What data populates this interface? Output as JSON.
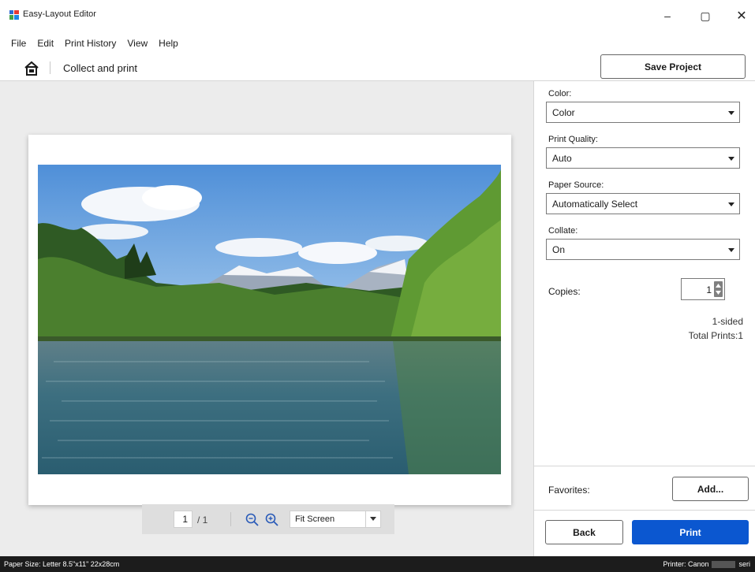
{
  "window": {
    "title": "Easy-Layout Editor",
    "minimize_glyph": "–",
    "maximize_glyph": "▢",
    "close_glyph": "✕"
  },
  "menu": {
    "items": [
      {
        "label": "File"
      },
      {
        "label": "Edit"
      },
      {
        "label": "Print History"
      },
      {
        "label": "View"
      },
      {
        "label": "Help"
      }
    ]
  },
  "breadcrumb": {
    "home_icon": "home-icon",
    "title": "Collect and print"
  },
  "toolbar": {
    "save_label": "Save Project"
  },
  "preview": {
    "photo_subject": "lake-landscape-photo",
    "page_current": "1",
    "page_total": "/ 1",
    "zoom_out_icon": "zoom-out-icon",
    "zoom_in_icon": "zoom-in-icon",
    "zoom_value": "Fit Screen"
  },
  "settings": {
    "color": {
      "label": "Color:",
      "value": "Color"
    },
    "print_quality": {
      "label": "Print Quality:",
      "value": "Auto"
    },
    "paper_source": {
      "label": "Paper Source:",
      "value": "Automatically Select"
    },
    "collate": {
      "label": "Collate:",
      "value": "On"
    },
    "copies": {
      "label": "Copies:",
      "value": "1"
    },
    "sided": "1-sided",
    "total_prints": "Total Prints:1"
  },
  "favorites": {
    "label": "Favorites:",
    "add_label": "Add..."
  },
  "actions": {
    "back_label": "Back",
    "print_label": "Print"
  },
  "status": {
    "paper_size": "Paper Size: Letter 8.5\"x11\" 22x28cm",
    "printer_prefix": "Printer: Canon",
    "printer_suffix": "seri"
  },
  "colors": {
    "accent": "#0b57d0",
    "status_bar": "#1c1c1c",
    "preview_bg": "#ececec"
  }
}
